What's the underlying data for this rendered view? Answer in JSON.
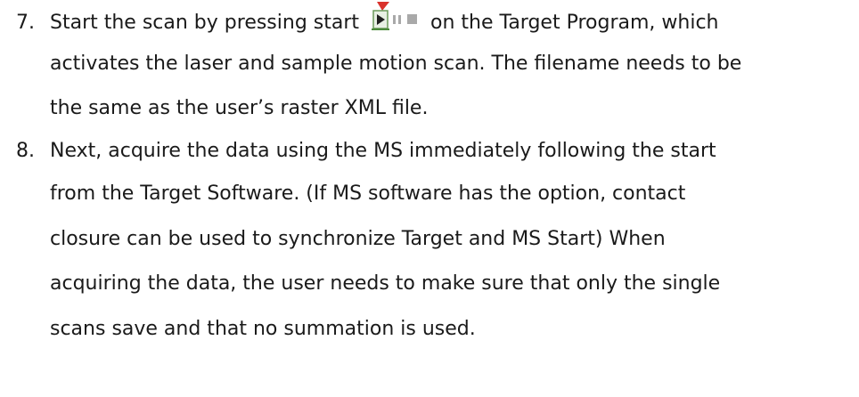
{
  "steps": [
    {
      "number": "7.",
      "lines": [
        {
          "before": "Start the scan by pressing start",
          "after": "on the Target Program, which"
        },
        {
          "text": "activates the laser and sample motion scan. The filename needs to be"
        },
        {
          "text": "the same as the user’s raster XML file."
        }
      ],
      "icon": "play-pause-stop-toolbar-icon"
    },
    {
      "number": "8.",
      "lines": [
        {
          "text": "Next, acquire the data using the MS immediately following the start"
        },
        {
          "text": "from the Target Software. (If MS software has the option, contact"
        },
        {
          "text": "closure can be used to synchronize Target and MS Start) When"
        },
        {
          "text": "acquiring the data, the user needs to make sure that only the single"
        },
        {
          "text": "scans save and that no summation is used."
        }
      ]
    }
  ],
  "colors": {
    "text": "#1a1a1a",
    "icon_green": "#4a8a3a",
    "icon_red": "#d9322c",
    "icon_gray": "#a9a9a9"
  }
}
